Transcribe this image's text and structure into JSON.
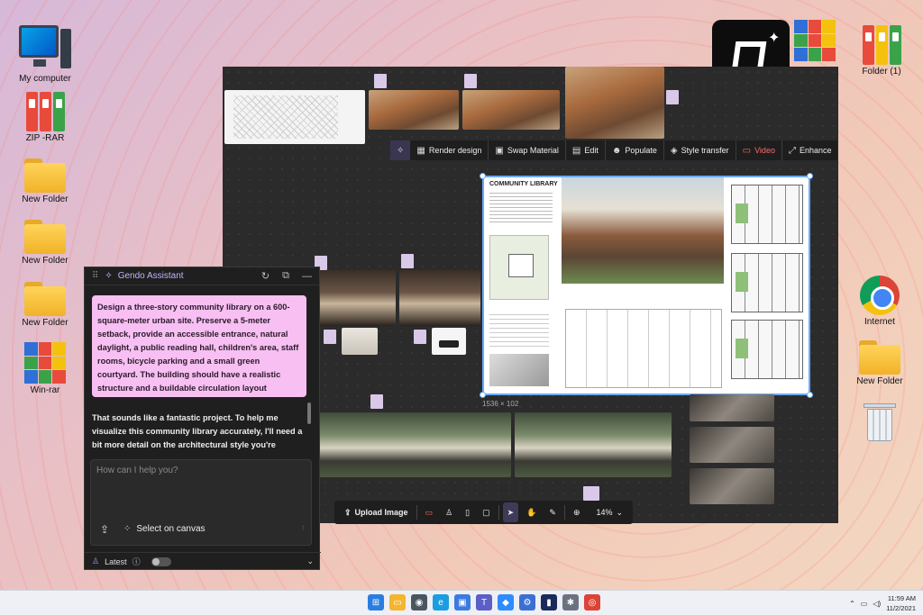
{
  "desktop": {
    "icons": [
      {
        "label": "My computer"
      },
      {
        "label": "ZIP -RAR"
      },
      {
        "label": "New Folder"
      },
      {
        "label": "New Folder"
      },
      {
        "label": "New Folder"
      },
      {
        "label": "Win-rar"
      },
      {
        "label": "Folder (1)"
      },
      {
        "label": "Internet"
      },
      {
        "label": "New Folder"
      }
    ]
  },
  "toolbar": {
    "items": [
      {
        "label": "",
        "icon": "sparkle-chat-icon"
      },
      {
        "label": "Render design",
        "icon": "render-icon"
      },
      {
        "label": "Swap Material",
        "icon": "swap-icon"
      },
      {
        "label": "Edit",
        "icon": "edit-icon"
      },
      {
        "label": "Populate",
        "icon": "people-icon"
      },
      {
        "label": "Style transfer",
        "icon": "style-icon"
      },
      {
        "label": "Video",
        "icon": "video-icon"
      },
      {
        "label": "Enhance",
        "icon": "enhance-icon"
      }
    ]
  },
  "board": {
    "title": "COMMUNITY LIBRARY",
    "size_label": "1536 × 102"
  },
  "bottombar": {
    "upload": "Upload Image",
    "zoom": "14%"
  },
  "assistant": {
    "title": "Gendo Assistant",
    "user_message": "Design a three-story community library on a 600-square-meter urban site. Preserve a 5-meter setback, provide an accessible entrance, natural daylight, a public reading hall, children's area, staff rooms, bicycle parking and a small green courtyard. The building should have a realistic structure and a buildable circulation layout",
    "bot_message": "That sounds like a fantastic project. To help me visualize this community library accurately, I'll need a bit more detail on the architectural style you're",
    "input_placeholder": "How can I help you?",
    "select_on_canvas": "Select on canvas",
    "latest": "Latest"
  },
  "taskbar": {
    "time": "11:59 AM",
    "date": "11/2/2021"
  }
}
